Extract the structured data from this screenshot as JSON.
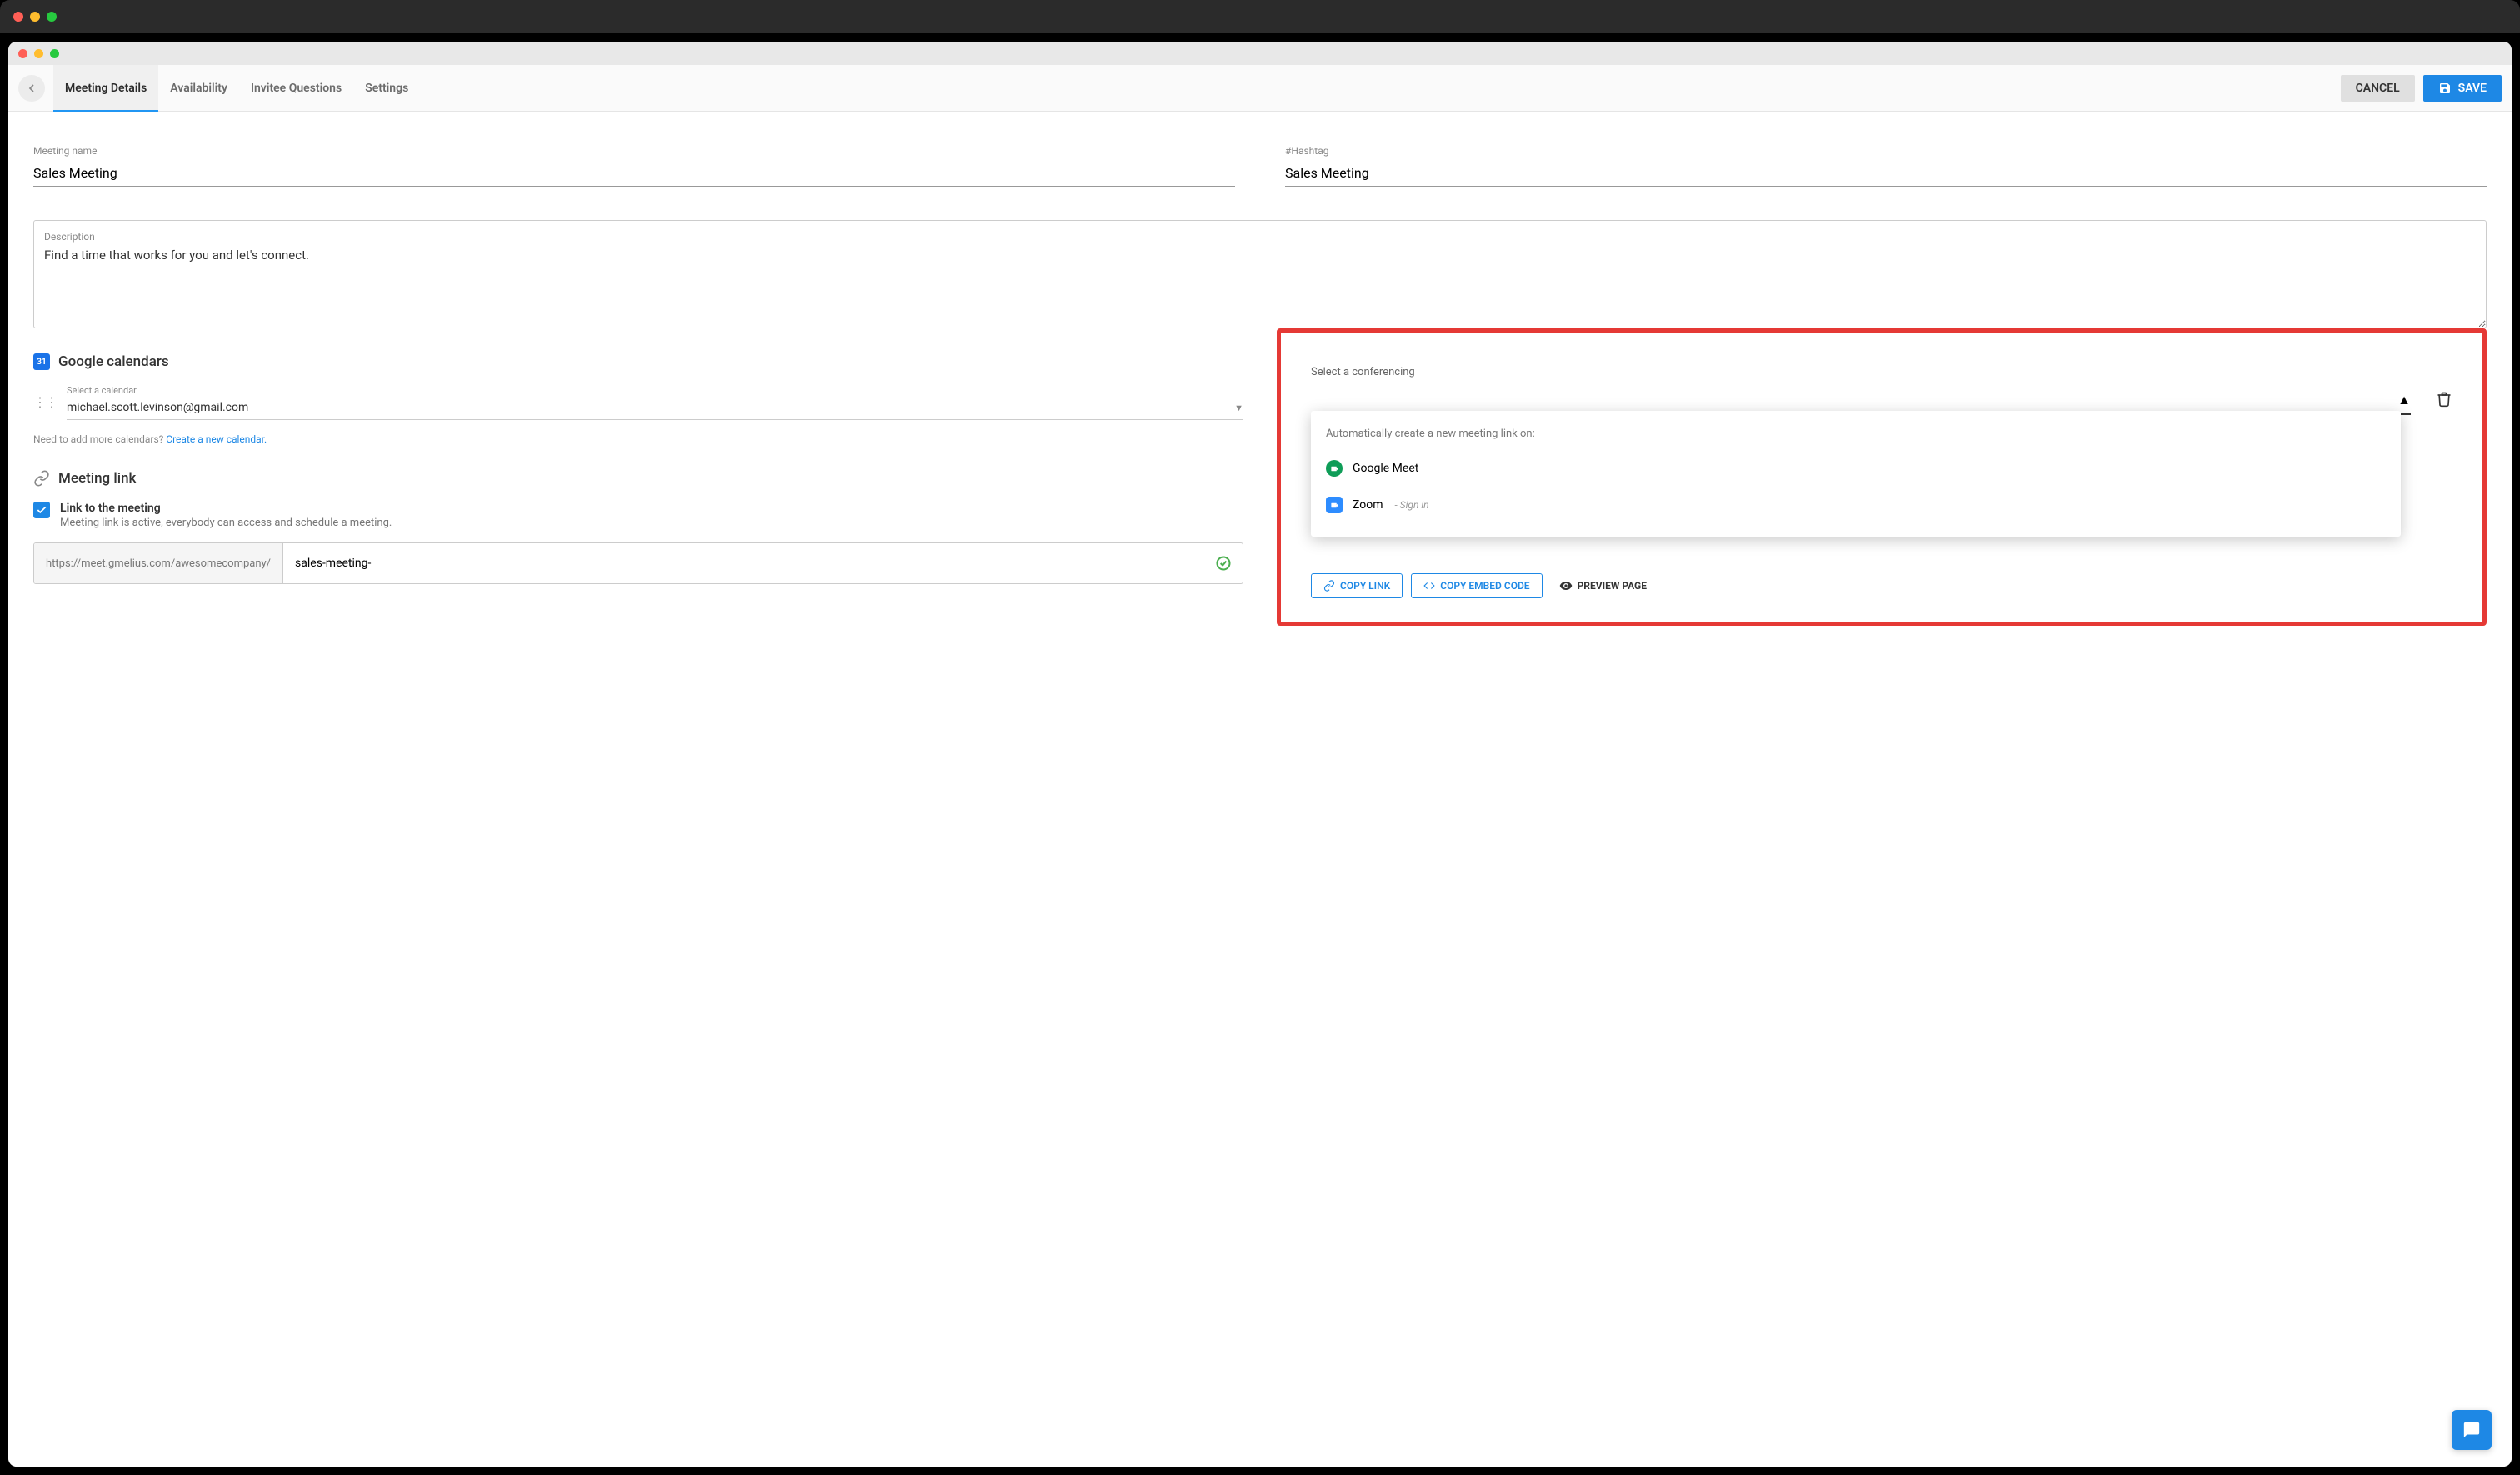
{
  "tabs": [
    "Meeting Details",
    "Availability",
    "Invitee Questions",
    "Settings"
  ],
  "active_tab": 0,
  "buttons": {
    "cancel": "CANCEL",
    "save": "SAVE"
  },
  "fields": {
    "meeting_name": {
      "label": "Meeting name",
      "value": "Sales Meeting"
    },
    "hashtag": {
      "label": "#Hashtag",
      "value": "Sales Meeting"
    },
    "description": {
      "label": "Description",
      "value": "Find a time that works for you and let's connect."
    }
  },
  "calendars": {
    "title": "Google calendars",
    "icon_text": "31",
    "select_label": "Select a calendar",
    "selected": "michael.scott.levinson@gmail.com",
    "hint_prefix": "Need to add more calendars? ",
    "hint_link": "Create a new calendar."
  },
  "meeting_link": {
    "title": "Meeting link",
    "toggle_title": "Link to the meeting",
    "toggle_sub": "Meeting link is active, everybody can access and schedule a meeting.",
    "checked": true,
    "url_prefix": "https://meet.gmelius.com/awesomecompany/",
    "url_slug": "sales-meeting-"
  },
  "conferencing": {
    "label": "Select a conferencing",
    "dropdown_header": "Automatically create a new meeting link on:",
    "options": [
      {
        "name": "Google Meet",
        "provider": "google_meet"
      },
      {
        "name": "Zoom",
        "provider": "zoom",
        "suffix": "- Sign in"
      }
    ],
    "actions": {
      "copy_link": "COPY LINK",
      "copy_embed": "COPY EMBED CODE",
      "preview": "PREVIEW PAGE"
    }
  }
}
